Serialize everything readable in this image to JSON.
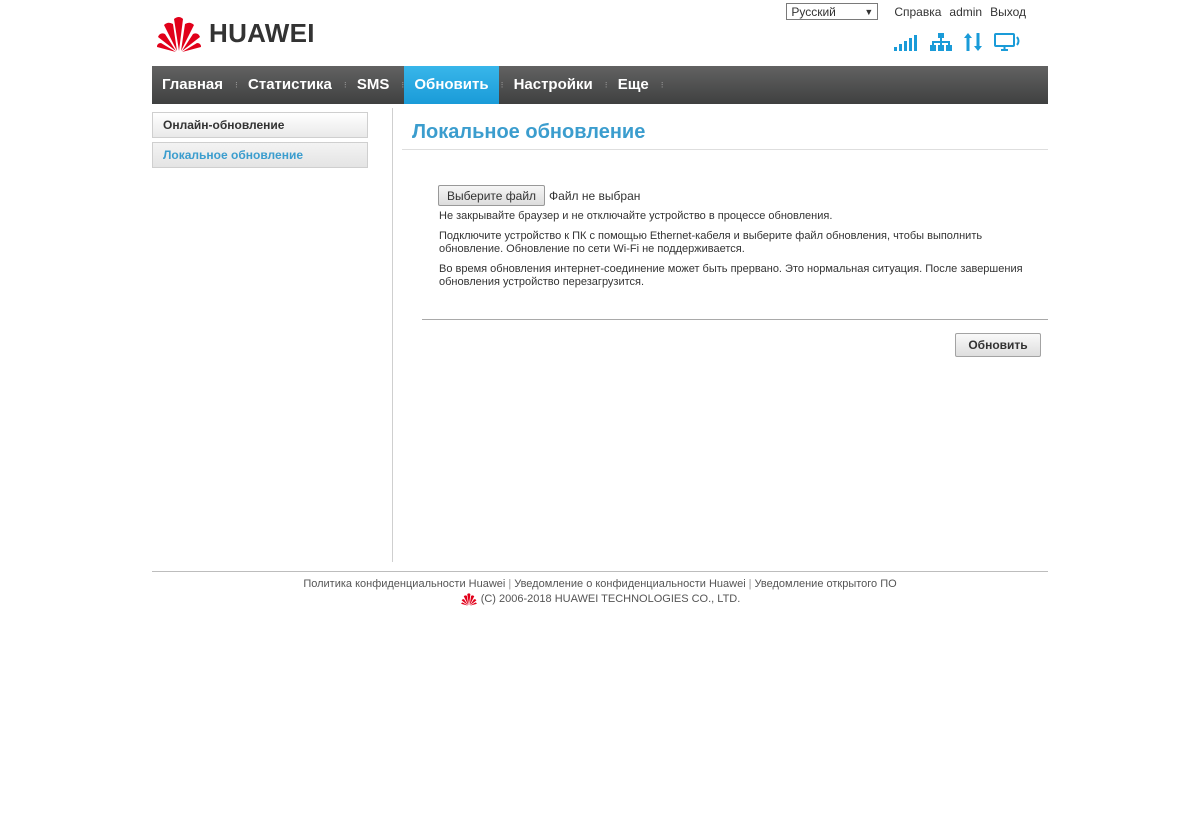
{
  "header": {
    "logo_text": "HUAWEI",
    "language": "Русский",
    "links": {
      "help": "Справка",
      "user": "admin",
      "logout": "Выход"
    },
    "status_icons": [
      "signal-strength-icon",
      "ethernet-icon",
      "data-transfer-icon",
      "pc-connection-icon"
    ],
    "icon_color": "#1a9bd8"
  },
  "nav": {
    "items": [
      {
        "label": "Главная"
      },
      {
        "label": "Статистика"
      },
      {
        "label": "SMS"
      },
      {
        "label": "Обновить",
        "active": true
      },
      {
        "label": "Настройки"
      },
      {
        "label": "Еще"
      }
    ],
    "active_color": "#1a9bd8"
  },
  "sidebar": {
    "items": [
      {
        "label": "Онлайн-обновление"
      },
      {
        "label": "Локальное обновление",
        "active": true
      }
    ]
  },
  "main": {
    "title": "Локальное обновление",
    "file_button": "Выберите файл",
    "file_status": "Файл не выбран",
    "notes": [
      "Не закрывайте браузер и не отключайте устройство в процессе обновления.",
      "Подключите устройство к ПК с помощью Ethernet-кабеля и выберите файл обновления, чтобы выполнить обновление. Обновление по сети Wi-Fi не поддерживается.",
      "Во время обновления интернет-соединение может быть прервано. Это нормальная ситуация. После завершения обновления устройство перезагрузится."
    ],
    "update_button": "Обновить"
  },
  "footer": {
    "links": [
      "Политика конфиденциальности Huawei",
      "Уведомление о конфиденциальности Huawei",
      "Уведомление открытого ПО"
    ],
    "copyright": "(C) 2006-2018 HUAWEI TECHNOLOGIES CO., LTD."
  }
}
